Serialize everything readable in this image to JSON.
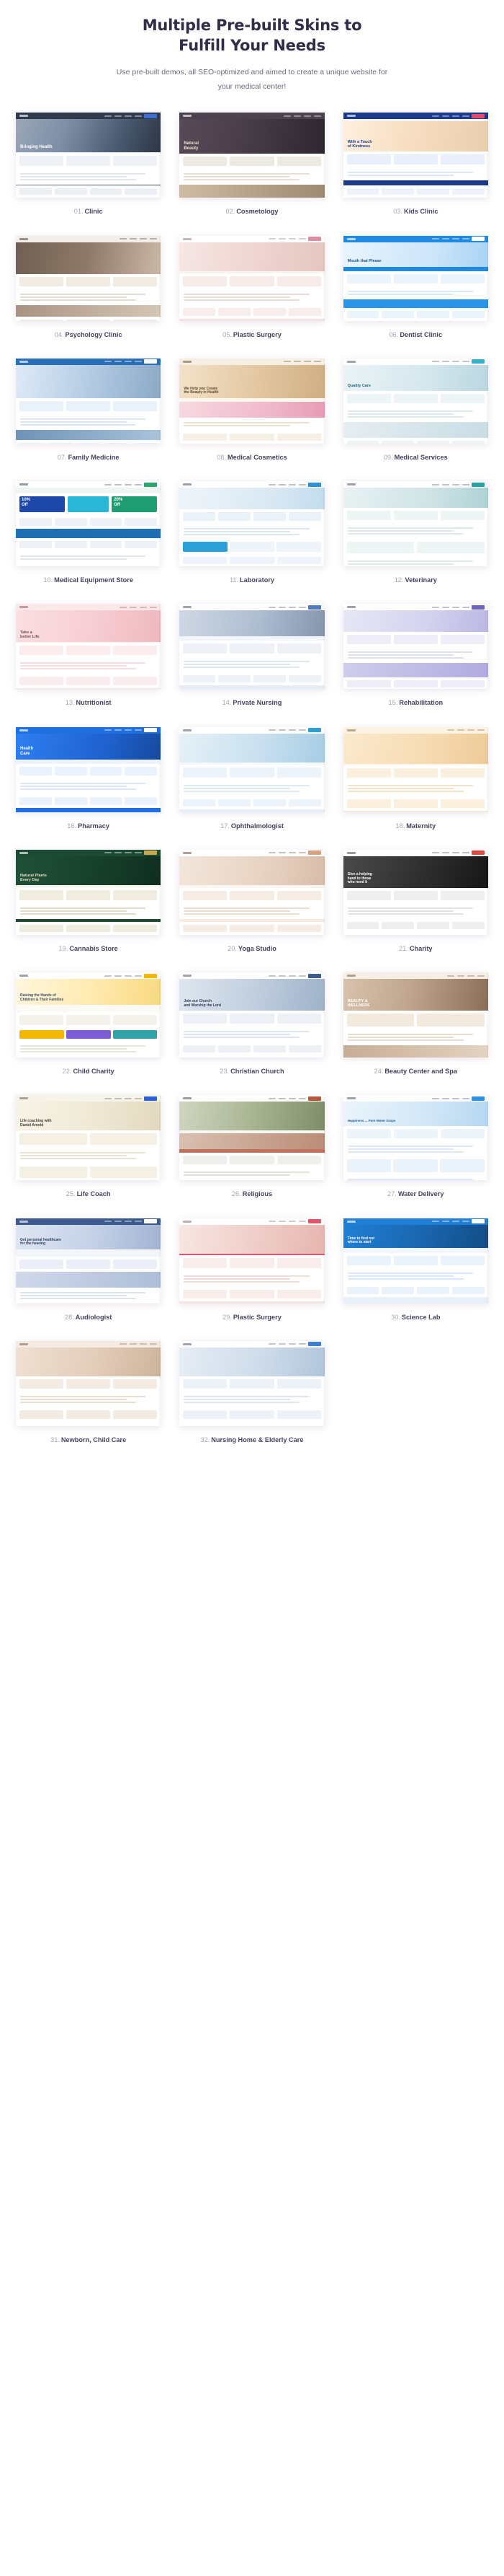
{
  "hero": {
    "title_line1": "Multiple Pre-built Skins to",
    "title_line2": "Fulfill Your Needs",
    "subtitle": "Use pre-built demos, all SEO-optimized and aimed to create a unique website for your medical center!"
  },
  "skins": [
    {
      "num": "01.",
      "name": "Clinic",
      "style": "clinic"
    },
    {
      "num": "02.",
      "name": "Cosmetology",
      "style": "cosmetology"
    },
    {
      "num": "03.",
      "name": "Kids Clinic",
      "style": "kids"
    },
    {
      "num": "04.",
      "name": "Psychology Clinic",
      "style": "psychology"
    },
    {
      "num": "05.",
      "name": "Plastic Surgery",
      "style": "plastic1"
    },
    {
      "num": "06.",
      "name": "Dentist Clinic",
      "style": "dentist"
    },
    {
      "num": "07.",
      "name": "Family Medicine",
      "style": "family"
    },
    {
      "num": "08.",
      "name": "Medical Cosmetics",
      "style": "medcosm"
    },
    {
      "num": "09.",
      "name": "Medical Services",
      "style": "medserv"
    },
    {
      "num": "10.",
      "name": "Medical Equipment Store",
      "style": "equipment"
    },
    {
      "num": "11.",
      "name": "Laboratory",
      "style": "laboratory"
    },
    {
      "num": "12.",
      "name": "Veterinary",
      "style": "veterinary"
    },
    {
      "num": "13.",
      "name": "Nutritionist",
      "style": "nutritionist"
    },
    {
      "num": "14.",
      "name": "Private Nursing",
      "style": "nursing"
    },
    {
      "num": "15.",
      "name": "Rehabilitation",
      "style": "rehab"
    },
    {
      "num": "16.",
      "name": "Pharmacy",
      "style": "pharmacy"
    },
    {
      "num": "17.",
      "name": "Ophthalmologist",
      "style": "ophthalmologist"
    },
    {
      "num": "18.",
      "name": "Maternity",
      "style": "maternity"
    },
    {
      "num": "19.",
      "name": "Cannabis Store",
      "style": "cannabis"
    },
    {
      "num": "20.",
      "name": "Yoga Studio",
      "style": "yoga"
    },
    {
      "num": "21.",
      "name": "Charity",
      "style": "charity"
    },
    {
      "num": "22.",
      "name": "Child Charity",
      "style": "childcharity"
    },
    {
      "num": "23.",
      "name": "Christian Church",
      "style": "church"
    },
    {
      "num": "24.",
      "name": "Beauty Center and Spa",
      "style": "beautyspa"
    },
    {
      "num": "25.",
      "name": "Life Coach",
      "style": "lifecoach"
    },
    {
      "num": "26.",
      "name": "Religious",
      "style": "religious"
    },
    {
      "num": "27.",
      "name": "Water Delivery",
      "style": "water"
    },
    {
      "num": "28.",
      "name": "Audiologist",
      "style": "audiologist"
    },
    {
      "num": "29.",
      "name": "Plastic Surgery",
      "style": "plastic2"
    },
    {
      "num": "30.",
      "name": "Science Lab",
      "style": "sciencelab"
    },
    {
      "num": "31.",
      "name": "Newborn, Child Care",
      "style": "newborn"
    },
    {
      "num": "32.",
      "name": "Nursing Home & Elderly Care",
      "style": "nursinghome"
    }
  ],
  "thumb_text": {
    "clinic_headline": "Bringing Health",
    "cosmetology_headline": "Natural Beauty",
    "kids_headline": "With a Touch of Kindness",
    "equipment_badge1": "10% Off",
    "equipment_badge2": "20% Off",
    "cannabis_headline": "Natural Plants Every Day"
  },
  "colors": {
    "title": "#332b4a",
    "subtitle": "#6f6b80",
    "caption": "#4a4160",
    "caption_num": "#a8a4b8",
    "page_bg": "#ffffff"
  }
}
